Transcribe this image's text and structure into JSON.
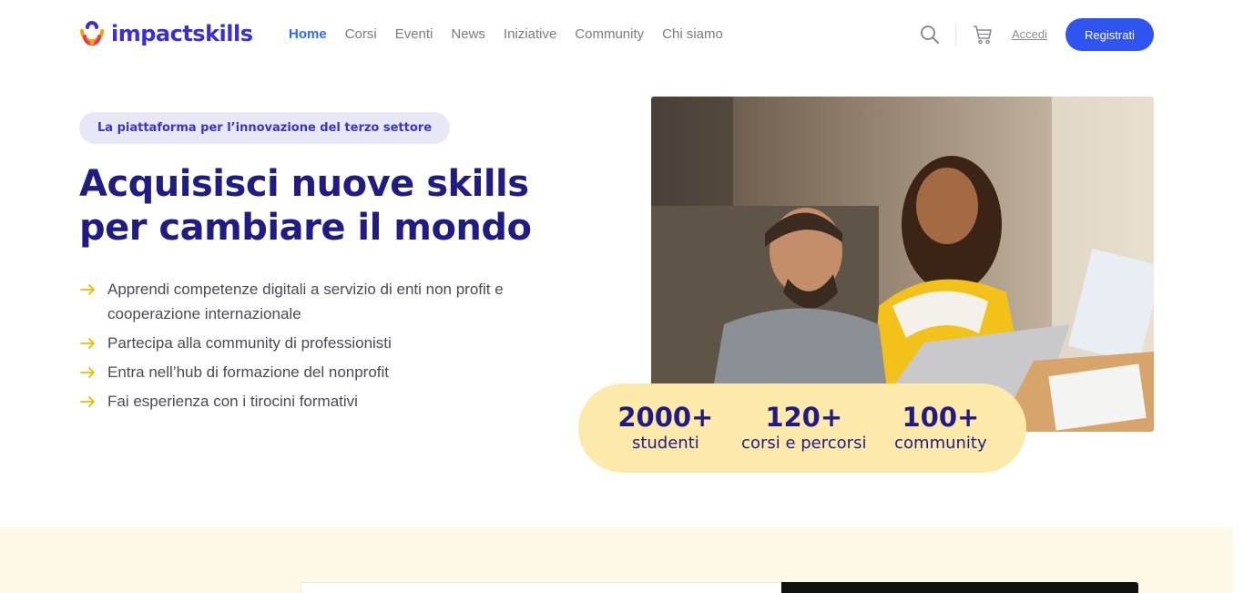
{
  "brand": {
    "name": "impactskills",
    "color": "#3a2fd6"
  },
  "nav": {
    "items": [
      {
        "label": "Home",
        "active": true
      },
      {
        "label": "Corsi",
        "active": false
      },
      {
        "label": "Eventi",
        "active": false
      },
      {
        "label": "News",
        "active": false
      },
      {
        "label": "Iniziative",
        "active": false
      },
      {
        "label": "Community",
        "active": false
      },
      {
        "label": "Chi siamo",
        "active": false
      }
    ],
    "icons": {
      "search": "search-icon",
      "cart": "cart-icon"
    },
    "login_label": "Accedi",
    "register_label": "Registrati"
  },
  "hero": {
    "badge": "La piattaforma per l’innovazione del terzo settore",
    "title": "Acquisisci nuove skills per cambiare il mondo",
    "benefits": [
      "Apprendi competenze digitali a servizio di enti non profit e cooperazione internazionale",
      "Partecipa alla community di professionisti",
      "Entra nell’hub di formazione del nonprofit",
      "Fai esperienza con i tirocini formativi"
    ],
    "photo": "photo of two people smiling at a laptop"
  },
  "stats": [
    {
      "value": "2000+",
      "label": "studenti"
    },
    {
      "value": "120+",
      "label": "corsi e percorsi"
    },
    {
      "value": "100+",
      "label": "community"
    }
  ],
  "colors": {
    "accent": "#2f54f2",
    "title": "#211c84",
    "stats_bg": "#fdeaab",
    "arrow": "#f5b800",
    "bottom_bg": "#fef8e7"
  }
}
